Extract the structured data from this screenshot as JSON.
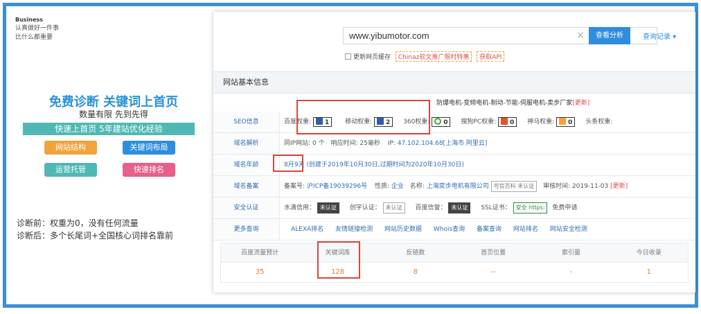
{
  "brand": {
    "line1": "Business",
    "line2": "认真做好一件事",
    "line3": "比什么都重要"
  },
  "promo": {
    "title": "免费诊断  关键词上首页",
    "subtitle": "数量有限 先到先得",
    "bar": "快速上首页  5年建站优化经验",
    "tags": [
      "网站结构",
      "关键词布局",
      "运营托管",
      "快速排名"
    ],
    "before": "诊断前：权重为0，没有任何流量",
    "after": "诊断后：多个长尾词+全国核心词排名靠前"
  },
  "search": {
    "value": "www.yibumotor.com",
    "clear": "×",
    "button": "查看分析",
    "history": "查询记录 ▾",
    "checkbox_label": "更新网页缓存",
    "promo_link": "Chinaz软文推广限时特惠",
    "api_link": "获取API"
  },
  "section": {
    "title": "网站基本信息",
    "desc": "防爆电机-变频电机-制动-节能-伺服电机-卖步厂家",
    "update": "[更新]"
  },
  "rows": {
    "seo": {
      "label": "SEO信息",
      "baidu_label": "百度权重:",
      "baidu_value": "1",
      "mobile_label": "移动权重:",
      "mobile_value": "2",
      "r360_label": "360权重:",
      "r360_value": "0",
      "sogou_label": "搜狗PC权重:",
      "sogou_value": "0",
      "shenma_label": "神马权重:",
      "shenma_value": "0",
      "toutiao_label": "头条权重:"
    },
    "dns": {
      "label": "域名解析",
      "same_ip_label": "同IP网站:",
      "same_ip_value": "0 个",
      "speed_label": "响应时间:",
      "speed_value": "25毫秒",
      "ip_label": "IP:",
      "ip_value": "47.102.104.68[上海市 阿里云]"
    },
    "age": {
      "label": "域名年龄",
      "value": "8月9天",
      "detail": "(创建于2019年10月30日,过期时间为2020年10月30日)"
    },
    "icp": {
      "label": "域名备案",
      "no_label": "备案号:",
      "no_value": "沪ICP备19039296号",
      "nature_label": "性质:",
      "nature_value": "企业",
      "name_label": "名称:",
      "name_value": "上海奕步电机有限公司",
      "trust_badge": "可信百科 未认证",
      "date_label": "审核时间:",
      "date_value": "2019-11-03",
      "update": "[更新]"
    },
    "security": {
      "label": "安全认证",
      "water_label": "水滴信用：",
      "water_badge": "未认证",
      "chuangyu_label": "创宇认证：",
      "chuangyu_badge": "未认证",
      "baidu_label": "百度信誉：",
      "baidu_badge": "未认证",
      "ssl_label": "SSL证书：",
      "ssl_badge": "安全 https:",
      "free": "免费申请"
    },
    "more": {
      "label": "更多查询",
      "links": [
        "ALEXA排名",
        "友情链接检测",
        "网站历史数据",
        "Whois查询",
        "备案查询",
        "网站排名",
        "网站安全检测"
      ]
    }
  },
  "stats": {
    "headers": [
      "百度流量预计",
      "关键词库",
      "反链数",
      "首页位置",
      "索引量",
      "今日收录"
    ],
    "values": [
      "35",
      "128",
      "8",
      "--",
      "-",
      "1"
    ]
  }
}
